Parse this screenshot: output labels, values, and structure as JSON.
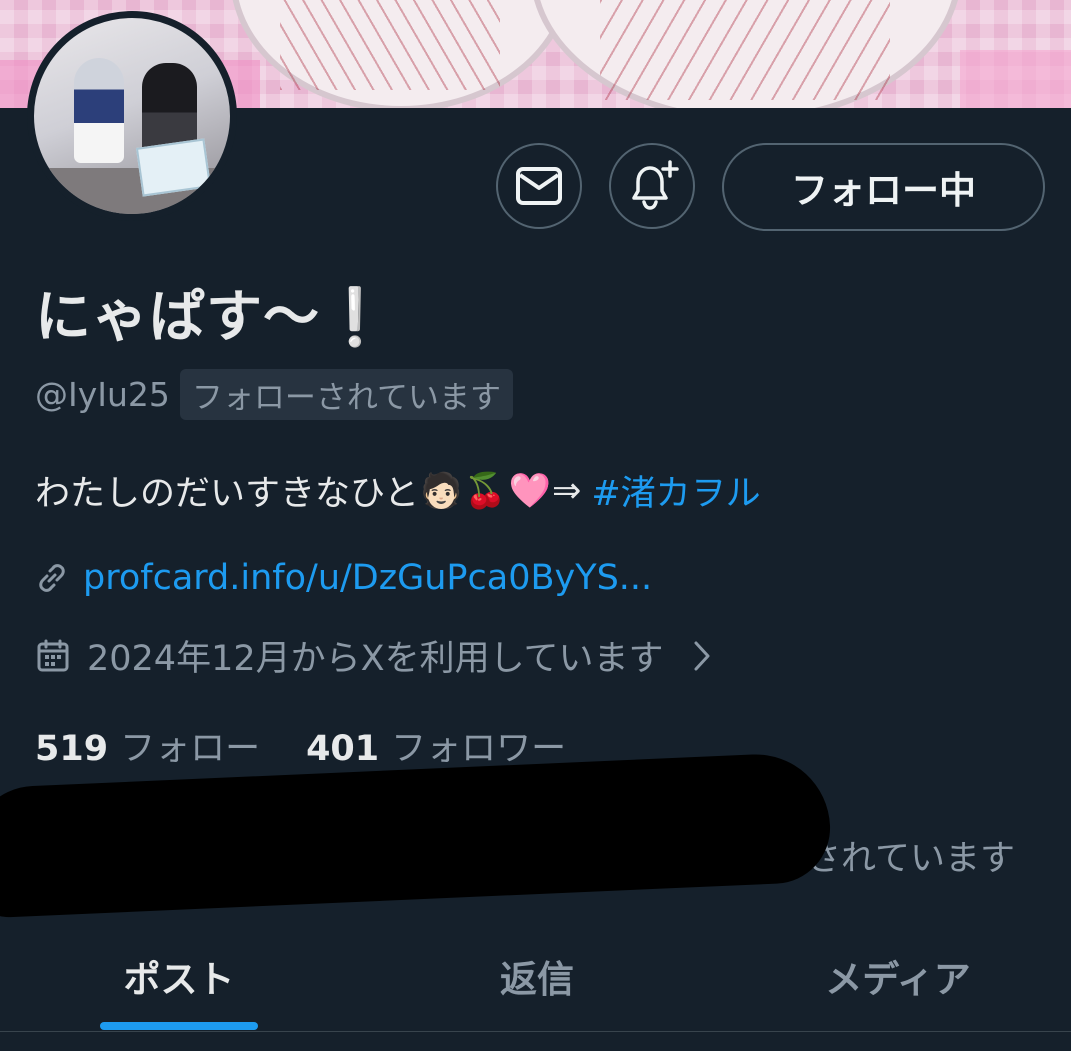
{
  "profile": {
    "display_name": "にゃぱす〜❕",
    "handle": "@IyIu25",
    "follows_you_label": "フォローされています",
    "bio_text": "わたしのだいすきなひと",
    "bio_emojis": [
      "🧑🏻",
      "🍒",
      "🩷"
    ],
    "bio_arrow": "⇒",
    "bio_hashtag": "#渚カヲル",
    "url": "profcard.info/u/DzGuPca0ByYS...",
    "joined": "2024年12月からXを利用しています",
    "following_count": "519",
    "following_label": "フォロー",
    "followers_count": "401",
    "followers_label": "フォロワー",
    "mutual_followers_text": "さんとさんにフォローされています"
  },
  "actions": {
    "message_icon": "envelope-icon",
    "notify_icon": "bell-plus-icon",
    "follow_button_label": "フォロー中"
  },
  "tabs": [
    {
      "label": "ポスト",
      "active": true
    },
    {
      "label": "返信",
      "active": false
    },
    {
      "label": "メディア",
      "active": false
    }
  ],
  "colors": {
    "background": "#15202b",
    "accent": "#1d9bf0",
    "muted_text": "#8b98a5",
    "border": "#536471"
  }
}
